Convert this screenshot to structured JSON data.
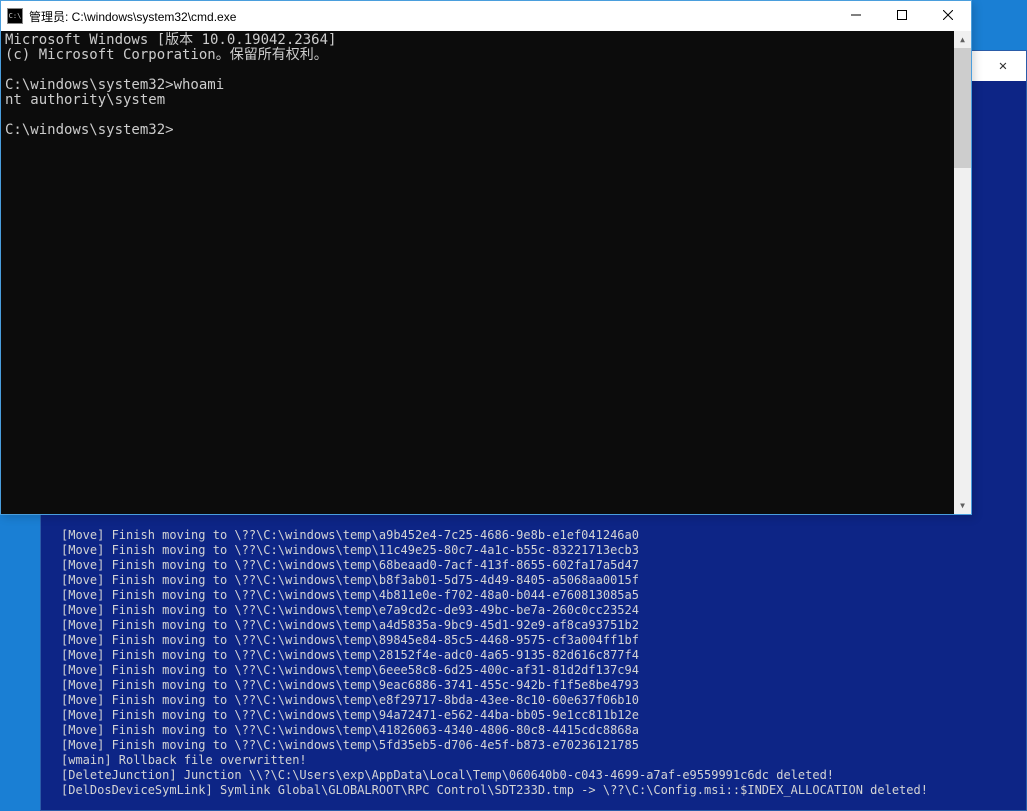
{
  "foreground": {
    "title": "管理员: C:\\windows\\system32\\cmd.exe",
    "icon_label": "C:\\",
    "content": "Microsoft Windows [版本 10.0.19042.2364]\n(c) Microsoft Corporation。保留所有权利。\n\nC:\\windows\\system32>whoami\nnt authority\\system\n\nC:\\windows\\system32>"
  },
  "background": {
    "close_label": "✕",
    "lines": [
      "[Move] Finish moving to \\??\\C:\\windows\\temp\\a9b452e4-7c25-4686-9e8b-e1ef041246a0",
      "[Move] Finish moving to \\??\\C:\\windows\\temp\\11c49e25-80c7-4a1c-b55c-83221713ecb3",
      "[Move] Finish moving to \\??\\C:\\windows\\temp\\68beaad0-7acf-413f-8655-602fa17a5d47",
      "[Move] Finish moving to \\??\\C:\\windows\\temp\\b8f3ab01-5d75-4d49-8405-a5068aa0015f",
      "[Move] Finish moving to \\??\\C:\\windows\\temp\\4b811e0e-f702-48a0-b044-e760813085a5",
      "[Move] Finish moving to \\??\\C:\\windows\\temp\\e7a9cd2c-de93-49bc-be7a-260c0cc23524",
      "[Move] Finish moving to \\??\\C:\\windows\\temp\\a4d5835a-9bc9-45d1-92e9-af8ca93751b2",
      "[Move] Finish moving to \\??\\C:\\windows\\temp\\89845e84-85c5-4468-9575-cf3a004ff1bf",
      "[Move] Finish moving to \\??\\C:\\windows\\temp\\28152f4e-adc0-4a65-9135-82d616c877f4",
      "[Move] Finish moving to \\??\\C:\\windows\\temp\\6eee58c8-6d25-400c-af31-81d2df137c94",
      "[Move] Finish moving to \\??\\C:\\windows\\temp\\9eac6886-3741-455c-942b-f1f5e8be4793",
      "[Move] Finish moving to \\??\\C:\\windows\\temp\\e8f29717-8bda-43ee-8c10-60e637f06b10",
      "[Move] Finish moving to \\??\\C:\\windows\\temp\\94a72471-e562-44ba-bb05-9e1cc811b12e",
      "[Move] Finish moving to \\??\\C:\\windows\\temp\\41826063-4340-4806-80c8-4415cdc8868a",
      "[Move] Finish moving to \\??\\C:\\windows\\temp\\5fd35eb5-d706-4e5f-b873-e70236121785",
      "[wmain] Rollback file overwritten!",
      "[DeleteJunction] Junction \\\\?\\C:\\Users\\exp\\AppData\\Local\\Temp\\060640b0-c043-4699-a7af-e9559991c6dc deleted!",
      "[DelDosDeviceSymLink] Symlink Global\\GLOBALROOT\\RPC Control\\SDT233D.tmp -> \\??\\C:\\Config.msi::$INDEX_ALLOCATION deleted!"
    ]
  }
}
